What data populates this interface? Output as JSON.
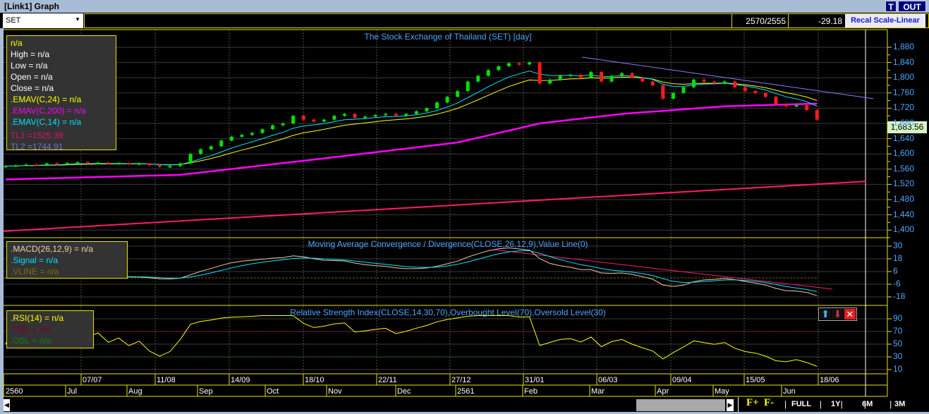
{
  "window": {
    "title": "[Link1] Graph",
    "btn_t": "T",
    "btn_out": "OUT"
  },
  "toolbar": {
    "symbol": "SET",
    "counts": "2570/2555",
    "change": "-29.18",
    "recal": "Recal Scale-Linear"
  },
  "main": {
    "title": "The Stock Exchange of Thailand (SET) [day]",
    "legend": [
      "n/a",
      "High  = n/a",
      "Low  = n/a",
      "Open  = n/a",
      "Close  = n/a"
    ],
    "ema24": ".EMAV(C,24)   = n/a",
    "ema200": ".EMAV(C,200)   = n/a",
    "ema14": ".EMAV(C,14)   = n/a",
    "tl1": "TL1 =1525.39",
    "tl2": "TL2 =1744.91",
    "last_price": "1,683.56",
    "yticks": [
      "1,880",
      "1,840",
      "1,800",
      "1,760",
      "1,720",
      "1,680",
      "1,640",
      "1,600",
      "1,560",
      "1,520",
      "1,480",
      "1,440",
      "1,400"
    ]
  },
  "macd": {
    "title": "Moving Average Convergence / Divergence(CLOSE,26,12,9),Value Line(0)",
    "l1": ".MACD(26,12,9)   = n/a",
    "l2": ".Signal   = n/a",
    "l3": ".VLINE   = n/a",
    "yticks": [
      "30",
      "18",
      "6",
      "-6",
      "-18"
    ]
  },
  "rsi": {
    "title": "Relative Strength Index(CLOSE,14,30,70),Overbought Level(70),Oversold Level(30)",
    "l1": ".RSI(14)   = n/a",
    "l2": ".OBL   = n/a",
    "l3": ".OSL   = n/a",
    "yticks": [
      "90",
      "70",
      "50",
      "30",
      "10"
    ]
  },
  "dates": [
    "07/07",
    "11/08",
    "14/09",
    "18/10",
    "22/11",
    "27/12",
    "31/01",
    "06/03",
    "09/04",
    "15/05",
    "18/06"
  ],
  "months": [
    "2560",
    "Jul",
    "Aug",
    "Sep",
    "Oct",
    "Nov",
    "Dec",
    "2561",
    "Feb",
    "Mar",
    "Apr",
    "May",
    "Jun"
  ],
  "controls": {
    "fplus": "F+",
    "fminus": "F-",
    "full": "FULL",
    "y1": "1Y",
    "m6": "6M",
    "m3": "3M"
  },
  "colors": {
    "up": "#00e000",
    "down": "#ff1a1a",
    "ema24": "#ffff00",
    "ema14": "#00e5ff",
    "ema200": "#ff00ff",
    "tl1": "#ff1a6e",
    "tl2": "#8080ff",
    "axis": "#4da6ff",
    "frame": "#e6e600"
  },
  "chart_data": {
    "type": "candlestick",
    "close": [
      1568,
      1570,
      1572,
      1571,
      1575,
      1573,
      1576,
      1578,
      1575,
      1577,
      1574,
      1576,
      1573,
      1575,
      1570,
      1566,
      1568,
      1575,
      1600,
      1612,
      1620,
      1635,
      1645,
      1650,
      1655,
      1665,
      1675,
      1680,
      1700,
      1690,
      1685,
      1690,
      1700,
      1705,
      1695,
      1698,
      1702,
      1705,
      1700,
      1705,
      1712,
      1720,
      1735,
      1750,
      1765,
      1790,
      1805,
      1820,
      1830,
      1838,
      1835,
      1840,
      1785,
      1795,
      1805,
      1808,
      1800,
      1815,
      1790,
      1805,
      1812,
      1800,
      1790,
      1780,
      1745,
      1760,
      1775,
      1795,
      1790,
      1785,
      1790,
      1775,
      1765,
      1760,
      1750,
      1730,
      1725,
      1728,
      1715,
      1690
    ],
    "ema200_points": [
      [
        0,
        1533
      ],
      [
        17,
        1545
      ],
      [
        30,
        1585
      ],
      [
        44,
        1630
      ],
      [
        52,
        1680
      ],
      [
        60,
        1705
      ],
      [
        70,
        1725
      ],
      [
        79,
        1732
      ]
    ],
    "tl1": [
      1397,
      1528
    ],
    "tl2": [
      1854,
      1745
    ],
    "price_ylim": [
      1400,
      1880
    ],
    "macd_ylim": [
      -18,
      30
    ],
    "rsi_ylim": [
      10,
      90
    ],
    "rsi_levels": [
      70,
      30
    ]
  }
}
